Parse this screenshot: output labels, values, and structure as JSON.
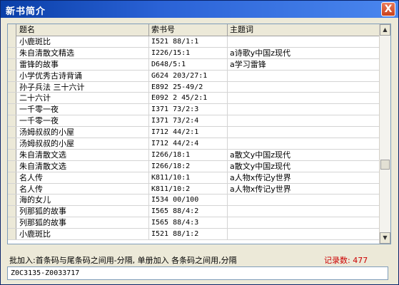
{
  "window": {
    "title": "新书简介",
    "close_label": "X"
  },
  "table": {
    "columns": [
      "题名",
      "索书号",
      "主题词"
    ],
    "rows": [
      [
        "小鹿斑比",
        "I521 88/1:1",
        ""
      ],
      [
        "朱自清散文精选",
        "I226/15:1",
        "a诗歌y中国z现代"
      ],
      [
        "雷锋的故事",
        "D648/5:1",
        "a学习雷锋"
      ],
      [
        "小学优秀古诗背诵",
        "G624 203/27:1",
        ""
      ],
      [
        "孙子兵法 三十六计",
        "E892 25-49/2",
        ""
      ],
      [
        "二十六计",
        "E092 2 45/2:1",
        ""
      ],
      [
        "一千零一夜",
        "I371 73/2:3",
        ""
      ],
      [
        "一千零一夜",
        "I371 73/2:4",
        ""
      ],
      [
        "汤姆叔叔的小屋",
        "I712 44/2:1",
        ""
      ],
      [
        "汤姆叔叔的小屋",
        "I712 44/2:4",
        ""
      ],
      [
        "朱自清散文选",
        "I266/18:1",
        "a散文y中国z现代"
      ],
      [
        "朱自清散文选",
        "I266/18:2",
        "a散文y中国z现代"
      ],
      [
        "名人传",
        "K811/10:1",
        "a人物x传记y世界"
      ],
      [
        "名人传",
        "K811/10:2",
        "a人物x传记y世界"
      ],
      [
        "海的女儿",
        "I534 00/100",
        ""
      ],
      [
        "列那狐的故事",
        "I565 88/4:2",
        ""
      ],
      [
        "列那狐的故事",
        "I565 88/4:3",
        ""
      ],
      [
        "小鹿斑比",
        "I521 88/1:2",
        ""
      ]
    ]
  },
  "footer": {
    "hint": "批加入:首条码与尾条码之间用-分隔, 单册加入 各条码之间用,分隔",
    "count_label": "记录数: 477",
    "barcode_value": "Z0C3135-Z0033717"
  },
  "colors": {
    "accent": "#0a3fa8",
    "count": "#cc0000"
  },
  "icons": {
    "close": "close-icon",
    "scroll_up": "triangle-up-icon",
    "scroll_down": "triangle-down-icon"
  }
}
